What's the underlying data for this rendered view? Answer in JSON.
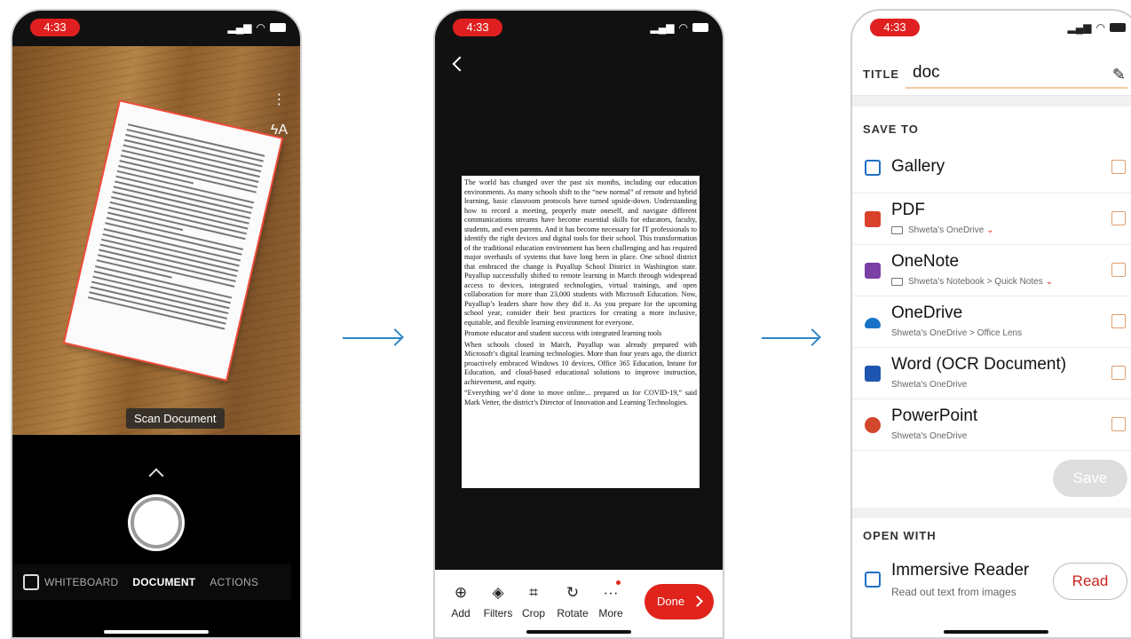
{
  "status_time": "4:33",
  "phone1": {
    "scan_label": "Scan Document",
    "modes": [
      "WHITEBOARD",
      "DOCUMENT",
      "ACTIONS"
    ],
    "active_mode": "DOCUMENT",
    "icons": [
      "more-vert-icon",
      "flash-auto-icon",
      "gallery-icon",
      "chevron-up-icon"
    ]
  },
  "phone2": {
    "paragraphs": [
      "The world has changed over the past six months, including our education environments. As many schools shift to the “new normal” of remote and hybrid learning, basic classroom protocols have turned upside-down. Understanding how to record a meeting, properly mute oneself, and navigate different communications streams have become essential skills for educators, faculty, students, and even parents. And it has become necessary for IT professionals to identify the right devices and digital tools for their school. This transformation of the traditional education environment has been challenging and has required major overhauls of systems that have long been in place. One school district that embraced the change is Puyallup School District in Washington state. Puyallup successfully shifted to remote learning in March through widespread access to devices, integrated technologies, virtual trainings, and open collaboration for more than 23,000 students with Microsoft Education. Now, Puyallup’s leaders share how they did it. As you prepare for the upcoming school year, consider their best practices for creating a more inclusive, equitable, and flexible learning environment for everyone.",
      "Promote educator and student success with integrated learning tools",
      "When schools closed in March, Puyallup was already prepared with Microsoft’s digital learning technologies. More than four years ago, the district proactively embraced Windows 10 devices, Office 365 Education, Intune for Education, and cloud-based educational solutions to improve instruction, achievement, and equity.",
      "“Everything we’d done to move online... prepared us for COVID-19,” said Mark Vetter, the district’s Director of Innovation and Learning Technologies."
    ],
    "tools": [
      {
        "label": "Add",
        "icon": "add-image-icon",
        "glyph": "⊕"
      },
      {
        "label": "Filters",
        "icon": "filters-icon",
        "glyph": "◈"
      },
      {
        "label": "Crop",
        "icon": "crop-icon",
        "glyph": "⌗"
      },
      {
        "label": "Rotate",
        "icon": "rotate-icon",
        "glyph": "↻"
      },
      {
        "label": "More",
        "icon": "more-icon",
        "glyph": "···"
      }
    ],
    "done_label": "Done"
  },
  "phone3": {
    "title_label": "TITLE",
    "title_value": "doc",
    "save_to_label": "SAVE TO",
    "destinations": [
      {
        "name": "Gallery",
        "sub": "",
        "icon": "gallery-icon",
        "color": "#1f6fc5"
      },
      {
        "name": "PDF",
        "sub": "Shweta's OneDrive",
        "icon": "pdf-icon",
        "color": "#d9412b"
      },
      {
        "name": "OneNote",
        "sub": "Shweta's Notebook > Quick Notes",
        "icon": "onenote-icon",
        "color": "#7b3fa6"
      },
      {
        "name": "OneDrive",
        "sub": "Shweta's OneDrive > Office Lens",
        "icon": "onedrive-icon",
        "color": "#1a73c9"
      },
      {
        "name": "Word (OCR Document)",
        "sub": "Shweta's OneDrive",
        "icon": "word-icon",
        "color": "#1d55b0"
      },
      {
        "name": "PowerPoint",
        "sub": "Shweta's OneDrive",
        "icon": "powerpoint-icon",
        "color": "#d3472c"
      }
    ],
    "save_label": "Save",
    "open_with_label": "OPEN WITH",
    "immersive_title": "Immersive Reader",
    "immersive_sub": "Read out text from images",
    "read_label": "Read"
  },
  "colors": {
    "accent_red": "#e0231b",
    "arrow_blue": "#2f86c5"
  }
}
